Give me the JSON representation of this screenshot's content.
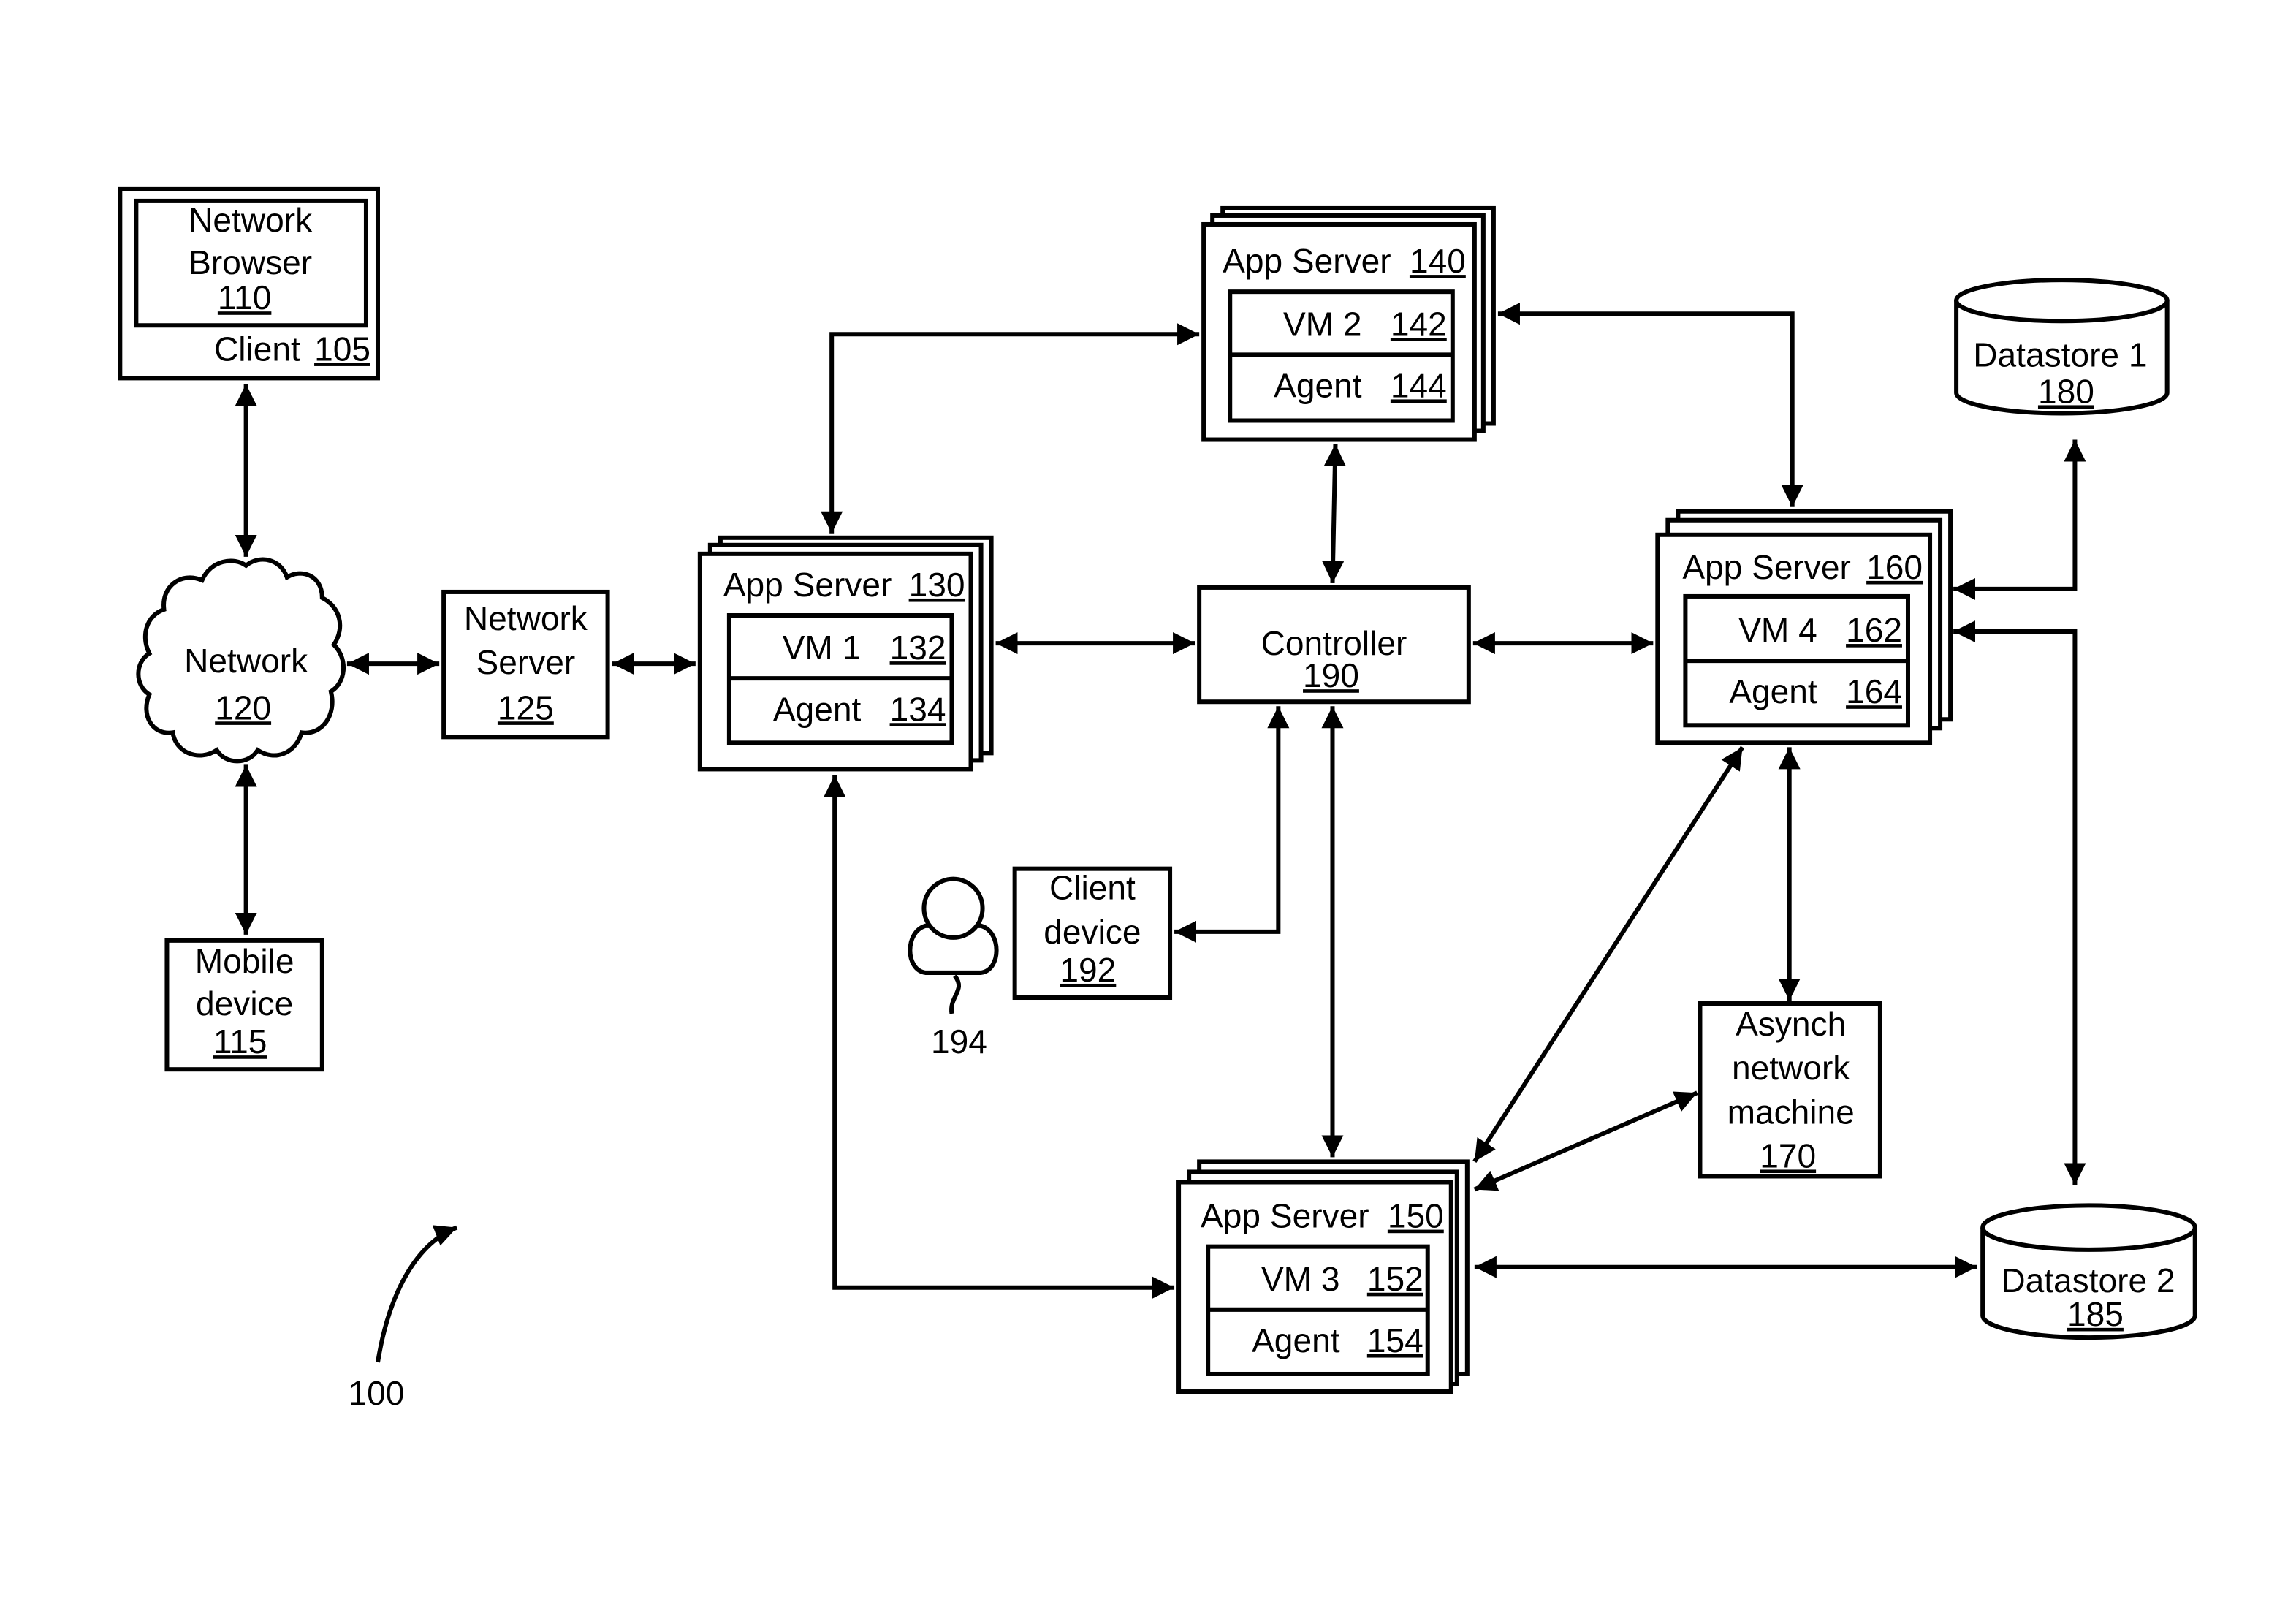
{
  "figure_label": "100",
  "colors": {
    "stroke": "#000000",
    "background": "#ffffff"
  },
  "nodes": {
    "client": {
      "label": "Client",
      "ref": "105"
    },
    "browser": {
      "line1": "Network",
      "line2": "Browser",
      "ref": "110"
    },
    "mobile": {
      "line1": "Mobile",
      "line2": "device",
      "ref": "115"
    },
    "network": {
      "label": "Network",
      "ref": "120"
    },
    "network_server": {
      "line1": "Network",
      "line2": "Server",
      "ref": "125"
    },
    "app_server_130": {
      "label": "App Server",
      "ref": "130",
      "vm_label": "VM 1",
      "vm_ref": "132",
      "agent_label": "Agent",
      "agent_ref": "134"
    },
    "app_server_140": {
      "label": "App Server",
      "ref": "140",
      "vm_label": "VM 2",
      "vm_ref": "142",
      "agent_label": "Agent",
      "agent_ref": "144"
    },
    "app_server_150": {
      "label": "App Server",
      "ref": "150",
      "vm_label": "VM 3",
      "vm_ref": "152",
      "agent_label": "Agent",
      "agent_ref": "154"
    },
    "app_server_160": {
      "label": "App Server",
      "ref": "160",
      "vm_label": "VM 4",
      "vm_ref": "162",
      "agent_label": "Agent",
      "agent_ref": "164"
    },
    "controller": {
      "label": "Controller",
      "ref": "190"
    },
    "client_device": {
      "line1": "Client",
      "line2": "device",
      "ref": "192"
    },
    "user": {
      "ref": "194"
    },
    "asynch": {
      "line1": "Asynch",
      "line2": "network",
      "line3": "machine",
      "ref": "170"
    },
    "datastore1": {
      "label": "Datastore 1",
      "ref": "180"
    },
    "datastore2": {
      "label": "Datastore 2",
      "ref": "185"
    }
  },
  "connections": [
    {
      "from": "client",
      "to": "network",
      "type": "bidirectional"
    },
    {
      "from": "network",
      "to": "mobile",
      "type": "bidirectional"
    },
    {
      "from": "network",
      "to": "network_server",
      "type": "bidirectional"
    },
    {
      "from": "network_server",
      "to": "app_server_130",
      "type": "bidirectional"
    },
    {
      "from": "app_server_130",
      "to": "app_server_140",
      "type": "bidirectional"
    },
    {
      "from": "app_server_130",
      "to": "controller",
      "type": "bidirectional"
    },
    {
      "from": "app_server_130",
      "to": "app_server_150",
      "type": "bidirectional"
    },
    {
      "from": "app_server_140",
      "to": "controller",
      "type": "bidirectional"
    },
    {
      "from": "app_server_140",
      "to": "app_server_160",
      "type": "bidirectional"
    },
    {
      "from": "controller",
      "to": "app_server_160",
      "type": "bidirectional"
    },
    {
      "from": "controller",
      "to": "client_device",
      "type": "bidirectional"
    },
    {
      "from": "controller",
      "to": "app_server_150",
      "type": "bidirectional"
    },
    {
      "from": "app_server_160",
      "to": "datastore1",
      "type": "bidirectional"
    },
    {
      "from": "app_server_160",
      "to": "datastore2",
      "type": "bidirectional"
    },
    {
      "from": "app_server_160",
      "to": "app_server_150",
      "type": "bidirectional"
    },
    {
      "from": "app_server_160",
      "to": "asynch",
      "type": "bidirectional"
    },
    {
      "from": "asynch",
      "to": "app_server_150",
      "type": "bidirectional"
    },
    {
      "from": "app_server_150",
      "to": "datastore2",
      "type": "bidirectional"
    }
  ]
}
